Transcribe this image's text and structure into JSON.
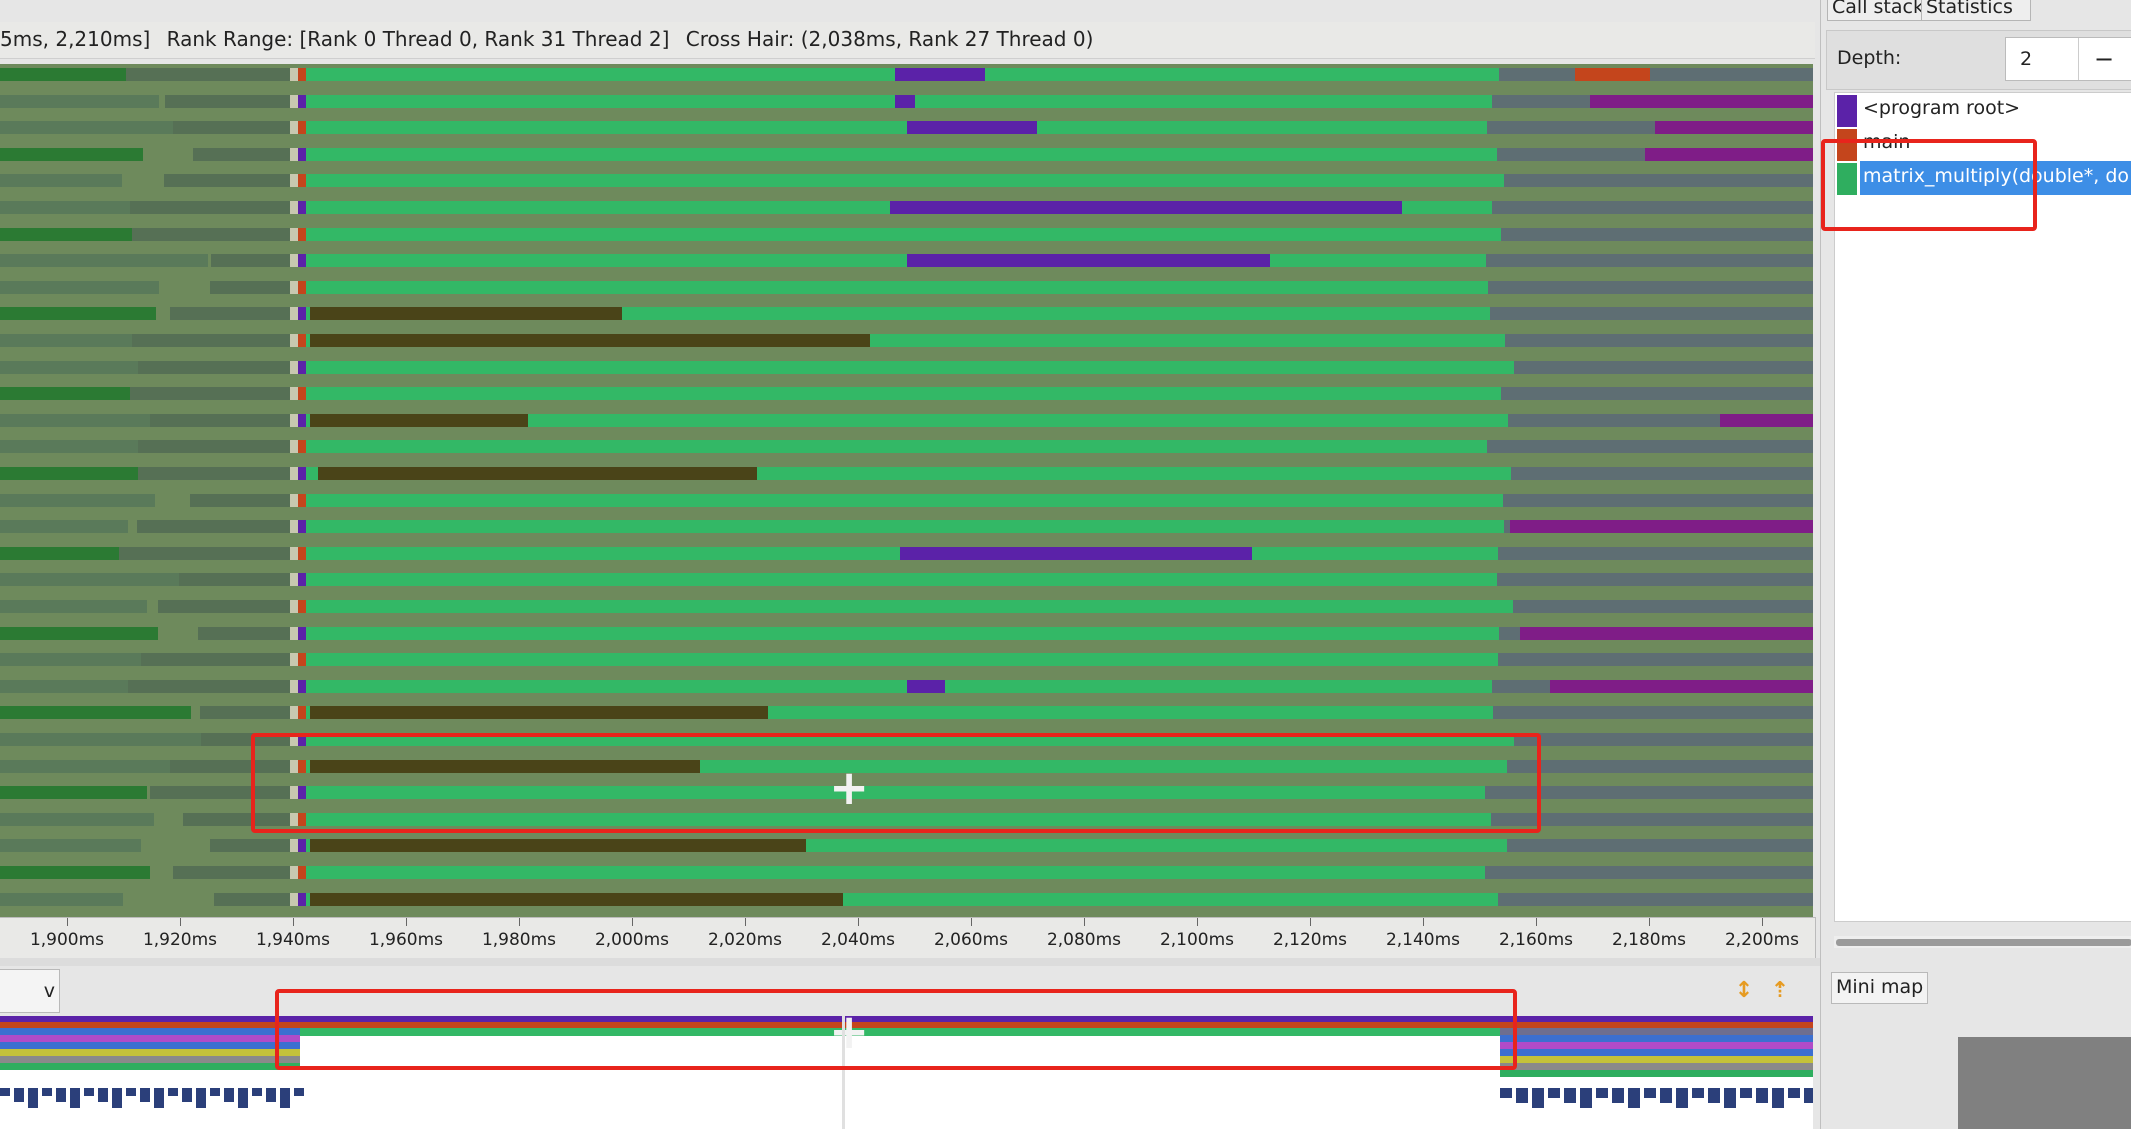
{
  "info": {
    "time_range": "5ms, 2,210ms]",
    "rank_range": "Rank Range: [Rank 0 Thread 0, Rank 31 Thread 2]",
    "cross_hair": "Cross Hair: (2,038ms, Rank 27 Thread 0)"
  },
  "axis": {
    "ticks": [
      "1,900ms",
      "1,920ms",
      "1,940ms",
      "1,960ms",
      "1,980ms",
      "2,000ms",
      "2,020ms",
      "2,040ms",
      "2,060ms",
      "2,080ms",
      "2,100ms",
      "2,120ms",
      "2,140ms",
      "2,160ms",
      "2,180ms",
      "2,200ms"
    ]
  },
  "overview": {
    "tab_label": "v view",
    "expand_icon": "expand-arrows-icon",
    "collapse_icon": "collapse-arrows-icon"
  },
  "right_panel": {
    "tabs": [
      "Call stack",
      "Statistics"
    ],
    "depth_label": "Depth:",
    "depth_value": "2",
    "depth_minus": "−",
    "call_stack": [
      {
        "label": "<program root>",
        "color": "#5b22a8",
        "selected": false
      },
      {
        "label": "main",
        "color": "#c4451c",
        "selected": false
      },
      {
        "label": "matrix_multiply(double*, do",
        "color": "#2fae5f",
        "selected": true
      }
    ]
  },
  "minimap": {
    "label": "Mini map"
  },
  "colors": {
    "compute": "#33b866",
    "mpi_wait": "#4a4418",
    "idle": "#5e6e73",
    "root": "#5b22a8",
    "main": "#c4451c",
    "barrier": "#7f1d87",
    "dark_green": "#2b7a33",
    "annotation": "#e8241c"
  }
}
